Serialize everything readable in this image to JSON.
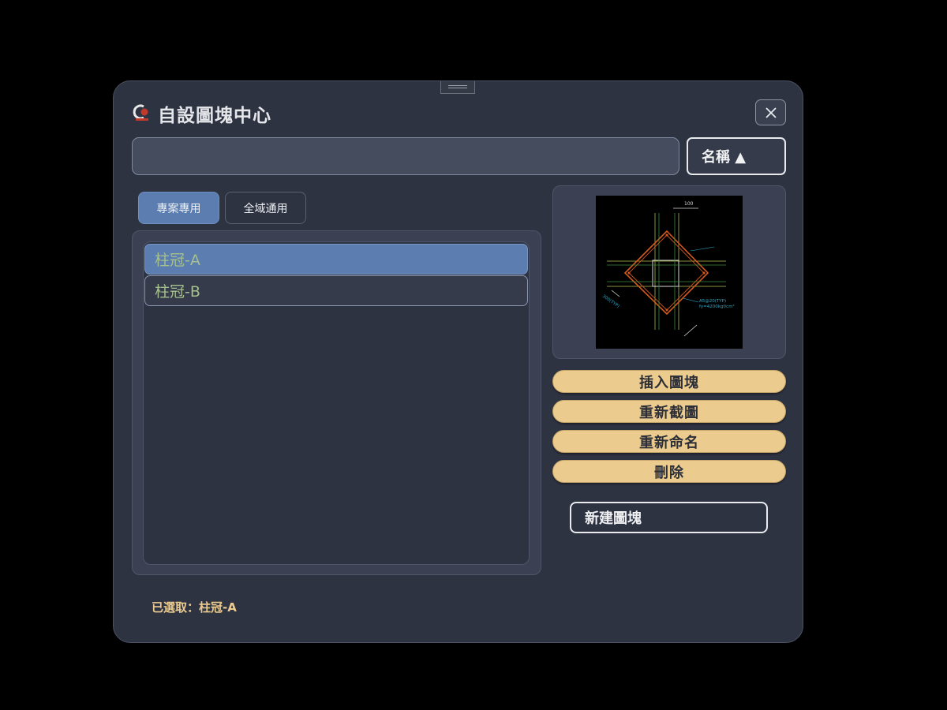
{
  "window": {
    "title": "自設圖塊中心",
    "close_icon": "close-icon",
    "logo_icon": "app-logo-icon"
  },
  "search": {
    "value": "",
    "placeholder": ""
  },
  "sort": {
    "label": "名稱 ▲"
  },
  "tabs": [
    {
      "label": "專案專用",
      "active": true
    },
    {
      "label": "全域通用",
      "active": false
    }
  ],
  "blocks": [
    {
      "name": "柱冠-A",
      "selected": true
    },
    {
      "name": "柱冠-B",
      "selected": false
    }
  ],
  "preview": {
    "dim_label": "100",
    "note_1": "A5@20(TYP)",
    "note_2": "fy=4200kgf/cm²",
    "note_3": "300(TYP)"
  },
  "actions": {
    "insert": "插入圖塊",
    "recapture": "重新截圖",
    "rename": "重新命名",
    "delete": "刪除",
    "new_block": "新建圖塊"
  },
  "status": {
    "text": "已選取：柱冠-A"
  },
  "colors": {
    "accent_blue": "#5b7db0",
    "action_gold": "#eccb8e",
    "item_text_green": "#a5c08d",
    "background": "#2e3342"
  }
}
